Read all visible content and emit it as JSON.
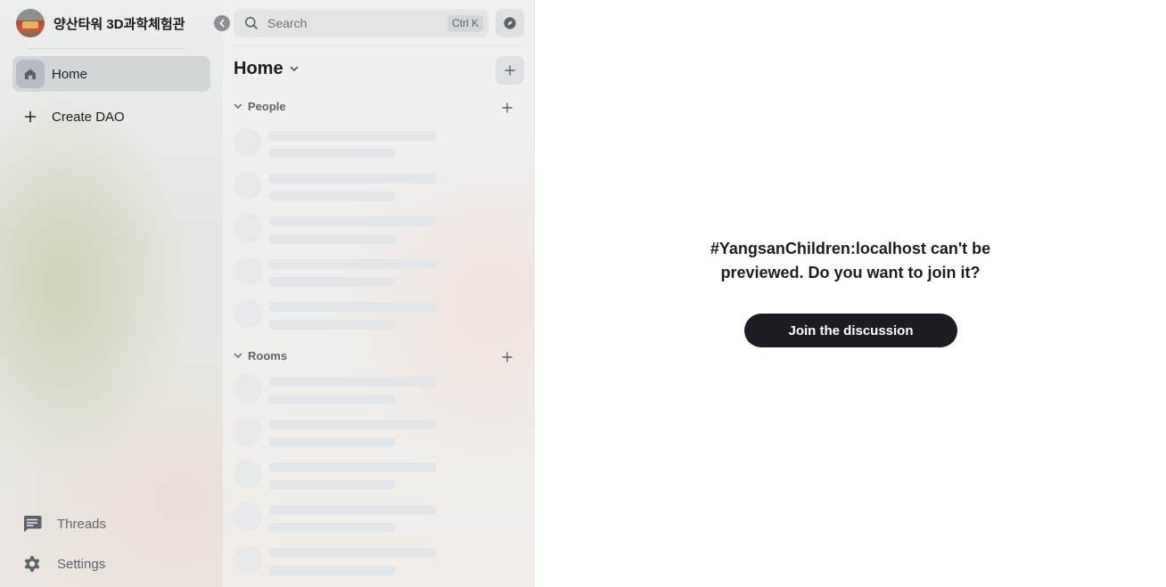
{
  "space": {
    "name": "양산타워 3D과학체험관",
    "avatar_icon": "space-avatar"
  },
  "nav": {
    "home_label": "Home",
    "create_label": "Create DAO"
  },
  "bottom_nav": {
    "threads_label": "Threads",
    "settings_label": "Settings"
  },
  "search": {
    "placeholder": "Search",
    "shortcut": "Ctrl K"
  },
  "room_list": {
    "title": "Home",
    "sections": {
      "people": "People",
      "rooms": "Rooms"
    }
  },
  "main": {
    "preview_message": "#YangsanChildren:localhost can't be previewed. Do you want to join it?",
    "join_button": "Join the discussion"
  },
  "colors": {
    "primary_button": "#1b1d22",
    "text_primary": "#1b1d22",
    "text_secondary": "#61656b"
  }
}
